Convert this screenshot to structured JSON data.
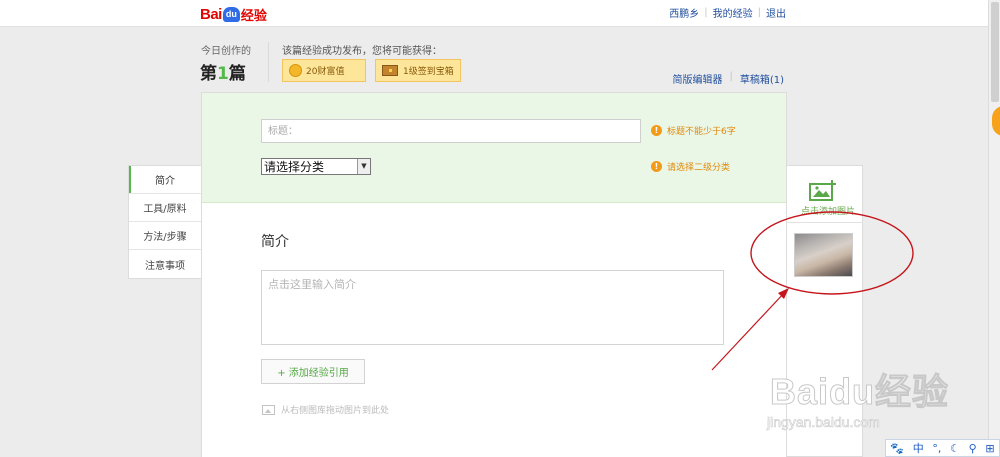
{
  "header": {
    "logo_bai": "Bai",
    "logo_du": "du",
    "logo_jy": "经验",
    "user_name": "西鹏乡",
    "my_experience": "我的经验",
    "logout": "退出"
  },
  "creation": {
    "today_label": "今日创作的",
    "count_prefix": "第",
    "count_number": "1",
    "count_suffix": "篇",
    "reward_label": "该篇经验成功发布，您将可能获得：",
    "reward_wealth": "20财富值",
    "reward_chest": "1级签到宝箱",
    "simple_editor": "简版编辑器",
    "drafts": "草稿箱(1)"
  },
  "form": {
    "title_placeholder": "标题：",
    "title_warning": "标题不能少于6字",
    "category_value": "请选择分类",
    "category_warning": "请选择二级分类",
    "section_heading": "简介",
    "intro_placeholder": "点击这里输入简介",
    "add_ref_label": "+ 添加经验引用",
    "drag_hint": "从右侧图库拖动图片到此处"
  },
  "left_nav": {
    "items": [
      {
        "label": "简介",
        "active": true
      },
      {
        "label": "工具/原料",
        "active": false
      },
      {
        "label": "方法/步骤",
        "active": false
      },
      {
        "label": "注意事项",
        "active": false
      }
    ]
  },
  "image_panel": {
    "add_label": "点击添加图片"
  },
  "watermark": {
    "brand": "Baidu经验",
    "site": "jingyan.baidu.com"
  },
  "ime": {
    "items": [
      "中",
      "°,",
      "☾",
      "⚲",
      "⊞"
    ]
  },
  "colors": {
    "brand_red": "#e10601",
    "accent_green": "#54b84a",
    "warning_orange": "#e08a0b",
    "link_blue": "#1f4e9e",
    "annotation_red": "#c4161c"
  }
}
